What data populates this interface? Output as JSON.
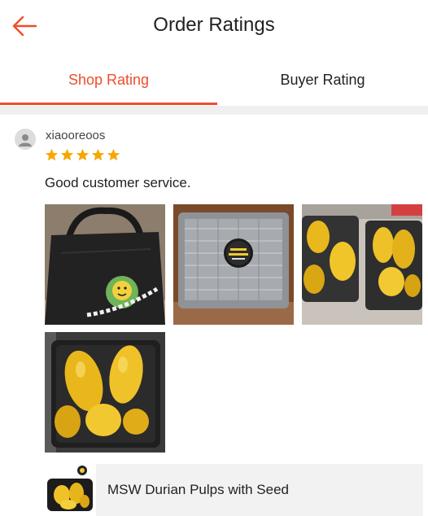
{
  "header": {
    "title": "Order Ratings",
    "back_icon": "arrow-left-icon"
  },
  "tabs": [
    {
      "label": "Shop Rating",
      "active": true
    },
    {
      "label": "Buyer Rating",
      "active": false
    }
  ],
  "colors": {
    "accent": "#ee4d2d",
    "star": "#f6a700"
  },
  "review": {
    "username": "xiaooreoos",
    "rating": 5,
    "rating_max": 5,
    "comment": "Good customer service.",
    "photo_count": 4
  },
  "product": {
    "name": "MSW Durian Pulps with Seed"
  }
}
